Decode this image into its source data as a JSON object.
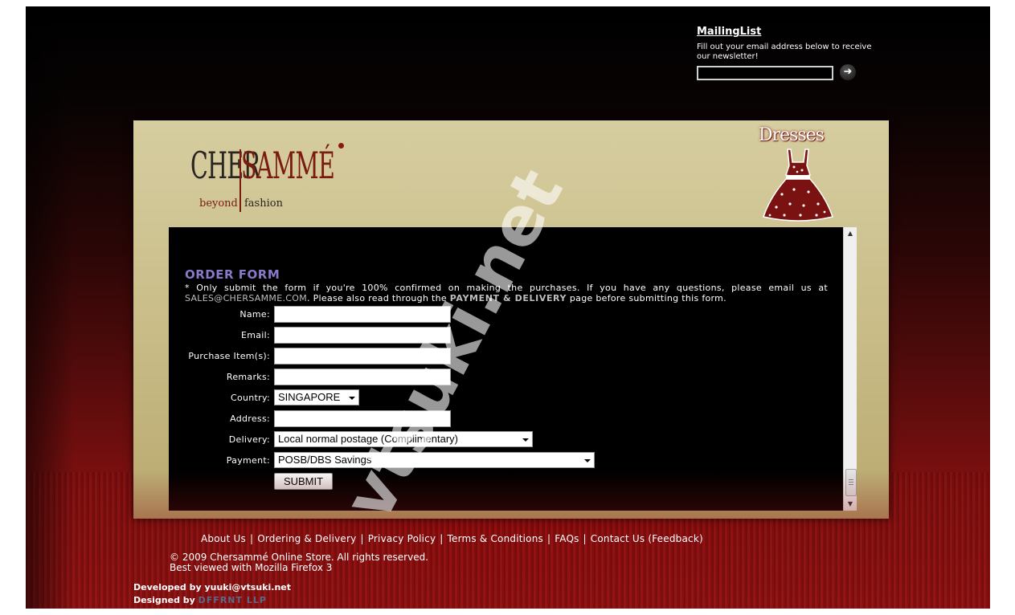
{
  "mailing_list": {
    "title": "MailingList",
    "description": "Fill out your email address below to receive our newsletter!",
    "email_value": "",
    "submit_icon": "arrow-right-icon"
  },
  "brand": {
    "logo_left": "CHER",
    "logo_right": "SAMMÉ",
    "tagline_left": "beyond",
    "tagline_right": "fashion",
    "section_title": "Dresses",
    "colors": {
      "gold": "#c8bb86",
      "maroon": "#7a1a10",
      "title_purple": "#8a78c8"
    }
  },
  "form": {
    "title": "ORDER FORM",
    "note_part1": "* Only submit the form if you're 100% confirmed on making the purchases. If you have any questions, please email us at ",
    "note_email": "SALES@CHERSAMME.COM",
    "note_part2": ". Please also read through the ",
    "note_link": "PAYMENT & DELIVERY",
    "note_part3": " page before submitting this form.",
    "fields": {
      "name": {
        "label": "Name:",
        "value": ""
      },
      "email": {
        "label": "Email:",
        "value": ""
      },
      "items": {
        "label": "Purchase Item(s):",
        "value": ""
      },
      "remarks": {
        "label": "Remarks:",
        "value": ""
      },
      "country": {
        "label": "Country:",
        "selected": "SINGAPORE"
      },
      "address": {
        "label": "Address:",
        "value": ""
      },
      "delivery": {
        "label": "Delivery:",
        "selected": "Local normal postage (Complimentary)"
      },
      "payment": {
        "label": "Payment:",
        "selected": "POSB/DBS Savings"
      }
    },
    "submit_label": "SUBMIT"
  },
  "footer": {
    "links": [
      "About Us",
      "Ordering & Delivery",
      "Privacy Policy",
      "Terms & Conditions",
      "FAQs",
      "Contact Us (Feedback)"
    ],
    "copyright": "© 2009 Chersammé Online Store. All rights reserved.",
    "best_viewed": "Best viewed with Mozilla Firefox 3",
    "developed_by": "Developed by yuuki@vtsuki.net",
    "designed_by_prefix": "Designed by ",
    "designed_by_company": "DFFRNT LLP"
  },
  "watermark": "vtsuki.net"
}
